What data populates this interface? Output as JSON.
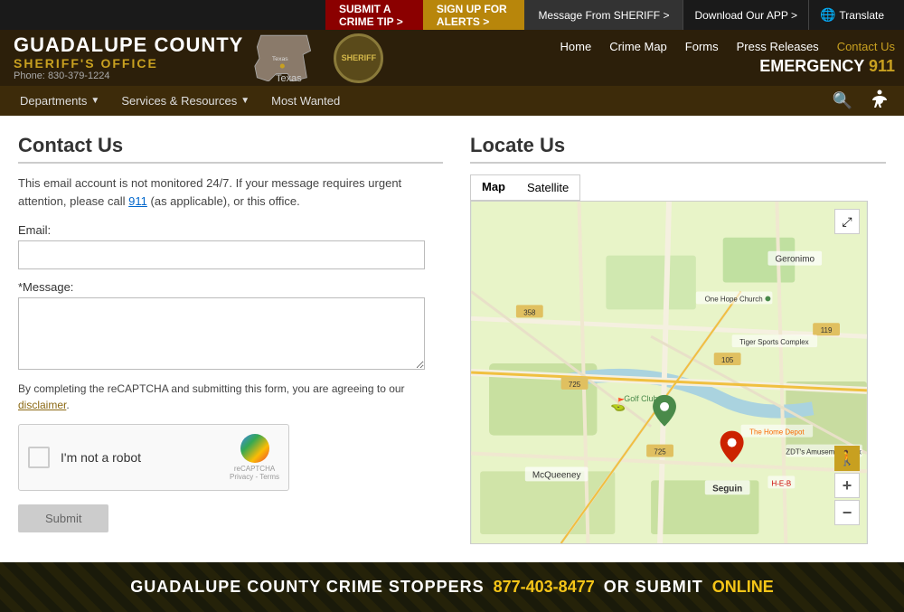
{
  "topbar": {
    "submit_tip_label": "SUBMIT A CRIME TIP >",
    "signup_alerts_label": "SIGN UP FOR ALERTS >",
    "message_sheriff_label": "Message From SHERIFF >",
    "download_app_label": "Download Our APP >",
    "translate_label": "Translate"
  },
  "header": {
    "title": "GUADALUPE COUNTY",
    "subtitle": "SHERIFF'S OFFICE",
    "phone_label": "Phone:",
    "phone_number": "830-379-1224",
    "texas_label": "Texas",
    "sheriff_label": "SHERIFF",
    "emergency_label": "EMERGENCY",
    "emergency_number": "911",
    "nav": {
      "home": "Home",
      "crime_map": "Crime Map",
      "forms": "Forms",
      "press_releases": "Press Releases",
      "contact_us": "Contact Us"
    }
  },
  "navbar": {
    "departments": "Departments",
    "services_resources": "Services & Resources",
    "most_wanted": "Most Wanted"
  },
  "contact": {
    "title": "Contact Us",
    "description": "This email account is not monitored 24/7. If your message requires urgent attention, please call",
    "call_link": "911",
    "description2": "(as applicable), or this office.",
    "email_label": "Email:",
    "email_placeholder": "",
    "message_label": "*Message:",
    "message_placeholder": "",
    "note": "By completing the reCAPTCHA and submitting this form, you are agreeing to our",
    "disclaimer_link": "disclaimer",
    "recaptcha_text": "I'm not a robot",
    "recaptcha_sub1": "reCAPTCHA",
    "recaptcha_sub2": "Privacy - Terms",
    "submit_label": "Submit"
  },
  "locate": {
    "title": "Locate Us",
    "map_tab": "Map",
    "satellite_tab": "Satellite"
  },
  "footer": {
    "text1": "GUADALUPE COUNTY CRIME STOPPERS",
    "phone": "877-403-8477",
    "text2": "OR SUBMIT",
    "online": "ONLINE"
  }
}
